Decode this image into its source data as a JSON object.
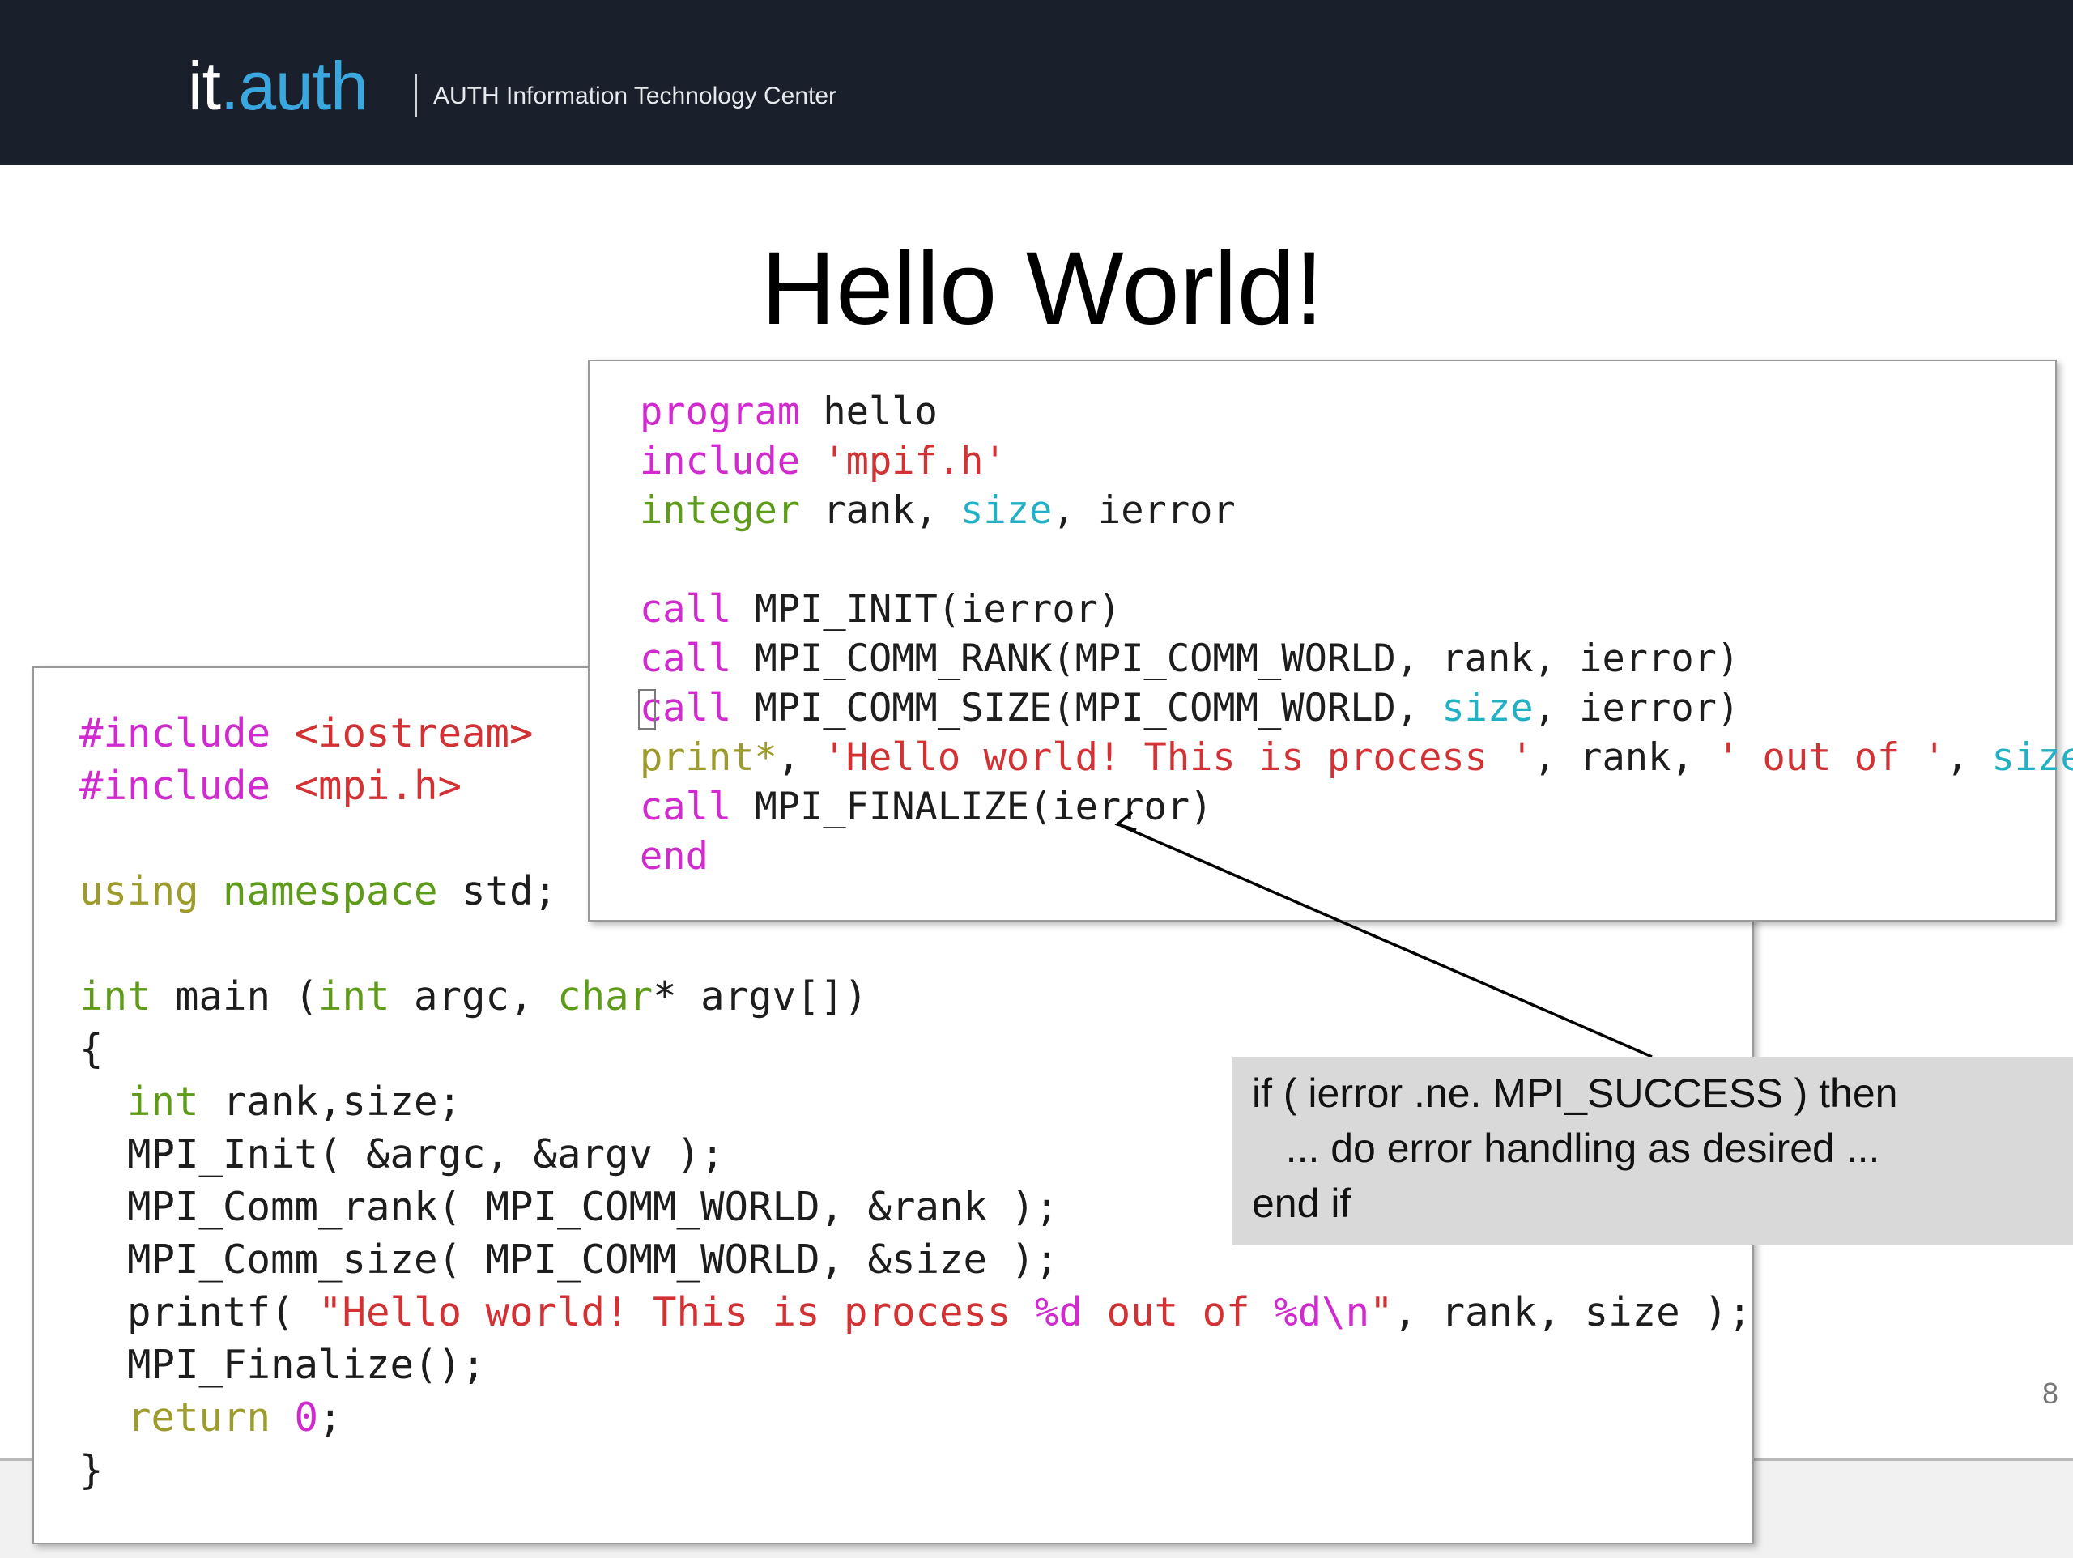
{
  "header": {
    "brand_it": "it",
    "brand_auth": ".auth",
    "subtitle": "AUTH Information Technology Center"
  },
  "slide": {
    "title": "Hello World!",
    "number": "8"
  },
  "cpp_code": {
    "include1_kw": "#include",
    "include1_val": "<iostream>",
    "include2_kw": "#include",
    "include2_val": "<mpi.h>",
    "using_kw": "using",
    "namespace_kw": "namespace",
    "using_rest": " std;",
    "main_int": "int",
    "main_mid": " main (",
    "main_int2": "int",
    "main_argc": " argc, ",
    "main_char": "char",
    "main_end": "* argv[])",
    "open_brace": "{",
    "decl_int": "int",
    "decl_rest": " rank,size;",
    "init_line": "MPI_Init( &argc, &argv );",
    "rank_line": "MPI_Comm_rank( MPI_COMM_WORLD, &rank );",
    "size_line": "MPI_Comm_size( MPI_COMM_WORLD, &size );",
    "printf_start": "printf( ",
    "printf_str1": "\"Hello world! This is process ",
    "printf_fmt1": "%d",
    "printf_str2": " out of ",
    "printf_fmt2": "%d\\n",
    "printf_str3": "\"",
    "printf_end": ", rank, size );",
    "finalize_line": "MPI_Finalize();",
    "return_kw": "return",
    "return_num": "0",
    "return_end": ";",
    "close_brace": "}"
  },
  "fortran_code": {
    "program_kw": "program",
    "program_name": " hello",
    "include_kw": "include",
    "include_val": " 'mpif.h'",
    "integer_kw": "integer",
    "integer_rest1": " rank, ",
    "size_kw": "size",
    "integer_rest2": ", ierror",
    "call1_kw": "call",
    "call1_rest": " MPI_INIT(ierror)",
    "call2_kw": "call",
    "call2_rest": " MPI_COMM_RANK(MPI_COMM_WORLD, rank, ierror)",
    "call3_kw": "call",
    "call3_rest1": " MPI_COMM_SIZE(MPI_COMM_WORLD, ",
    "call3_size": "size",
    "call3_rest2": ", ierror)",
    "print_kw": "print*",
    "print_comma": ", ",
    "print_str1": "'Hello world! This is process '",
    "print_mid": ", rank, ",
    "print_str2": "' out of '",
    "print_comma2": ", ",
    "print_size": "size",
    "call4_kw": "call",
    "call4_rest": " MPI_FINALIZE(ierror)",
    "end_kw": "end"
  },
  "note": {
    "line1": "if ( ierror .ne. MPI_SUCCESS ) then",
    "line2": "   ... do error handling as desired ...",
    "line3": "end if"
  },
  "colors": {
    "header_bg": "#1a202b",
    "brand_accent": "#3aa7df",
    "keyword_magenta": "#d12bd0",
    "keyword_green": "#5f9b1a",
    "keyword_olive": "#9c9b2b",
    "keyword_cyan": "#22b0c4",
    "string_red": "#d23234",
    "note_bg": "#d9d9d9"
  }
}
